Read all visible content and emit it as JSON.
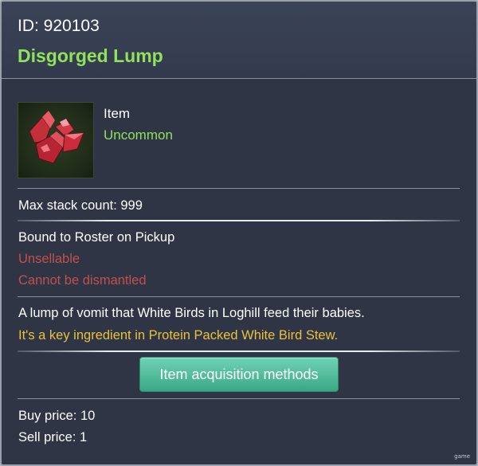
{
  "header": {
    "id_text": "ID: 920103",
    "name": "Disgorged Lump"
  },
  "summary": {
    "icon": "red-crystal-lump-icon",
    "type": "Item",
    "rarity": "Uncommon"
  },
  "stack": {
    "text": "Max stack count: 999"
  },
  "restrictions": {
    "binding": "Bound to Roster on Pickup",
    "sell": "Unsellable",
    "dismantle": "Cannot be dismantled"
  },
  "description": {
    "line1": "A lump of vomit that White Birds in Loghill feed their babies.",
    "line2": "It's a key ingredient in Protein Packed White Bird Stew."
  },
  "actions": {
    "acquisition_label": "Item acquisition methods"
  },
  "prices": {
    "buy": "Buy price: 10",
    "sell": "Sell price: 1"
  },
  "watermark": "game",
  "colors": {
    "name_green": "#8fe25a",
    "warning_red": "#c0504e",
    "lore_yellow": "#e8c23c",
    "button_teal": "#4cbc96",
    "panel_bg": "#2f3545"
  }
}
